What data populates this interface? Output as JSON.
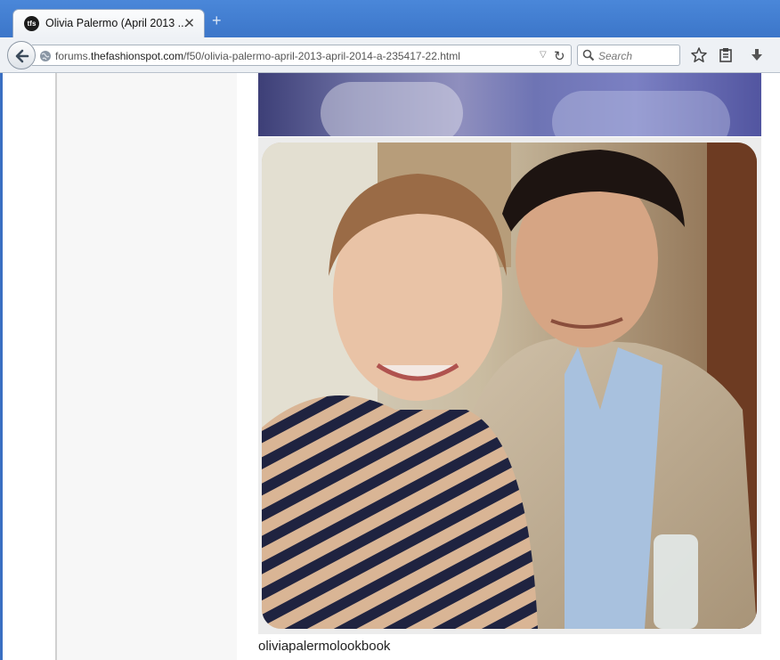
{
  "tab": {
    "title": "Olivia Palermo (April 2013 ...",
    "close": "✕",
    "favicon_text": "tfs"
  },
  "new_tab": "+",
  "navbar": {
    "url_prefix": "forums.",
    "url_domain": "thefashionspot.com",
    "url_path": "/f50/olivia-palermo-april-2013-april-2014-a-235417-22.html",
    "search_placeholder": "Search",
    "icons": [
      "back-arrow-icon",
      "globe-icon",
      "dropdown-icon",
      "reload-icon",
      "search-icon",
      "star-icon",
      "clipboard-icon",
      "download-icon"
    ]
  },
  "post": {
    "caption": "oliviapalermolookbook",
    "images": [
      "photo-partial-top",
      "photo-couple"
    ]
  },
  "colors": {
    "titlebar": "#3c76c9",
    "navbar": "#eef1f5",
    "sidebar": "#f7f7f7"
  }
}
